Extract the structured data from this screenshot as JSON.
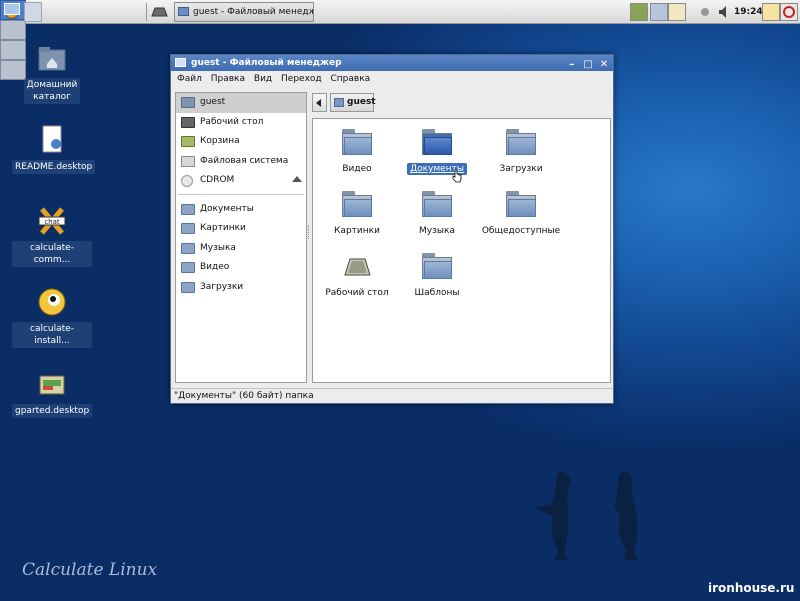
{
  "panel": {
    "task_title": "guest - Файловый менеджер",
    "clock": "19:24"
  },
  "desktop_icons": [
    {
      "label_line1": "Домашний",
      "label_line2": "каталог"
    },
    {
      "label": "README.desktop"
    },
    {
      "label": "calculate-comm..."
    },
    {
      "label": "calculate-install..."
    },
    {
      "label": "gparted.desktop"
    }
  ],
  "window": {
    "title": "guest - Файловый менеджер",
    "menu": [
      "Файл",
      "Правка",
      "Вид",
      "Переход",
      "Справка"
    ],
    "sidebar": {
      "places": [
        {
          "label": "guest",
          "icon": "home-folder-icon",
          "selected": true
        },
        {
          "label": "Рабочий стол",
          "icon": "desktop-icon"
        },
        {
          "label": "Корзина",
          "icon": "trash-icon"
        },
        {
          "label": "Файловая система",
          "icon": "drive-icon"
        },
        {
          "label": "CDROM",
          "icon": "cdrom-icon"
        }
      ],
      "bookmarks": [
        {
          "label": "Документы"
        },
        {
          "label": "Картинки"
        },
        {
          "label": "Музыка"
        },
        {
          "label": "Видео"
        },
        {
          "label": "Загрузки"
        }
      ]
    },
    "path": {
      "current": "guest"
    },
    "files": [
      {
        "label": "Видео"
      },
      {
        "label": "Документы",
        "selected": true
      },
      {
        "label": "Загрузки"
      },
      {
        "label": "Картинки"
      },
      {
        "label": "Музыка"
      },
      {
        "label": "Общедоступные"
      },
      {
        "label": "Рабочий стол"
      },
      {
        "label": "Шаблоны"
      }
    ],
    "status": "\"Документы\" (60 байт) папка"
  },
  "branding": {
    "logo_text": "Calculate Linux",
    "watermark": "ironhouse.ru"
  },
  "colors": {
    "selection": "#3d6fb8",
    "titlebar": "#4a77bb",
    "desktop": "#124a93"
  }
}
